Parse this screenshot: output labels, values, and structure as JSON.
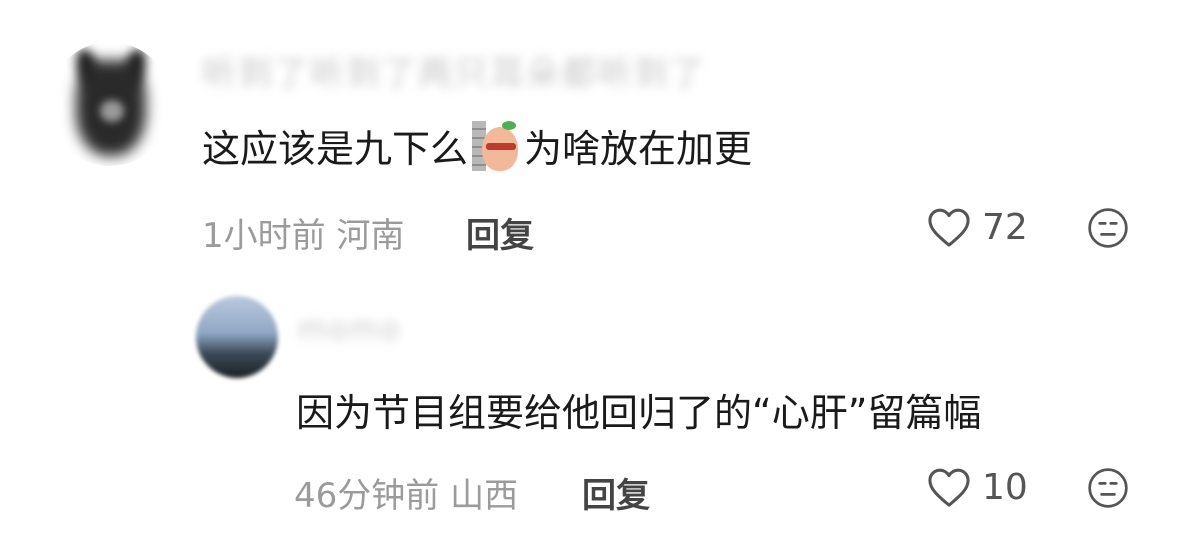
{
  "comments": [
    {
      "username": "听到了听到了两只耳朵都听到了",
      "text_before": "这应该是九下么",
      "sticker": "peeking-peach-sticker",
      "text_after": "为啥放在加更",
      "time": "1小时前",
      "location": "河南",
      "reply_label": "回复",
      "likes": "72",
      "icons": {
        "like": "heart-outline-icon",
        "react": "meh-face-icon"
      }
    },
    {
      "username": "momo",
      "text": "因为节目组要给他回归了的“心肝”留篇幅",
      "time": "46分钟前",
      "location": "山西",
      "reply_label": "回复",
      "likes": "10",
      "icons": {
        "like": "heart-outline-icon",
        "react": "meh-face-icon"
      }
    }
  ],
  "colors": {
    "text": "#1a1a1a",
    "meta": "#9b9b9b",
    "reply": "#444444",
    "background": "#ffffff"
  }
}
